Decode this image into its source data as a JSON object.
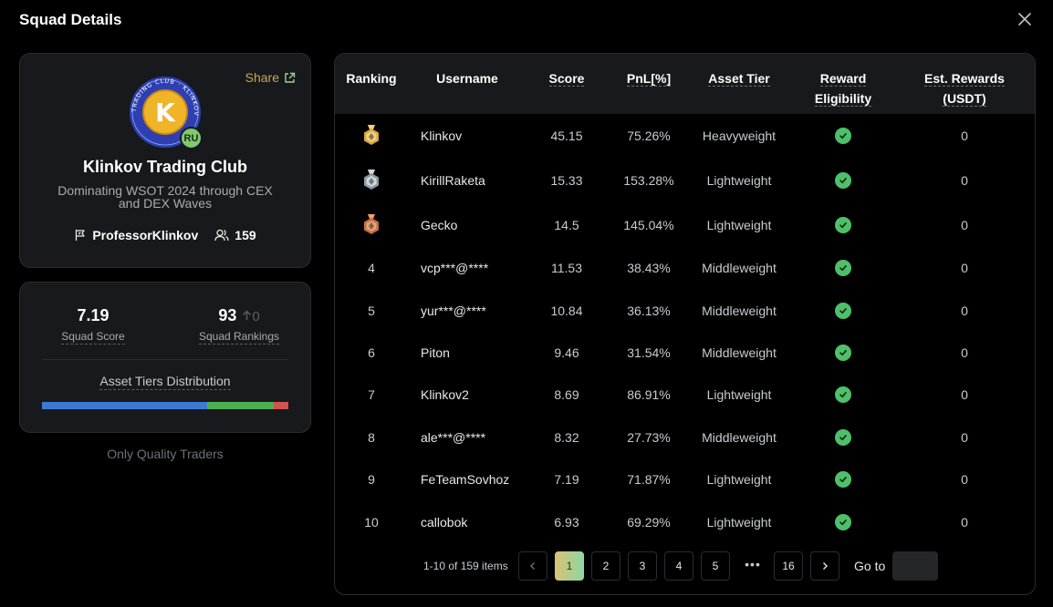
{
  "modal": {
    "title": "Squad Details"
  },
  "squad": {
    "share_label": "Share",
    "logo_text": "TRADING CLUB · KLINKOV",
    "logo_letter": "K",
    "region_badge": "RU",
    "name": "Klinkov Trading Club",
    "description": "Dominating WSOT 2024 through CEX and DEX Waves",
    "owner": "ProfessorKlinkov",
    "members": "159"
  },
  "stats": {
    "score_value": "7.19",
    "score_label": "Squad Score",
    "ranking_value": "93",
    "ranking_delta": "0",
    "ranking_label": "Squad Rankings",
    "distribution_label": "Asset Tiers Distribution",
    "distribution": [
      {
        "tier": "Lightweight",
        "share": 0.67,
        "color": "#3b7bd4"
      },
      {
        "tier": "Middleweight",
        "share": 0.27,
        "color": "#4caf50"
      },
      {
        "tier": "Heavyweight",
        "share": 0.06,
        "color": "#d25252"
      }
    ],
    "quality_note": "Only Quality Traders"
  },
  "table": {
    "headers": {
      "ranking": "Ranking",
      "username": "Username",
      "score": "Score",
      "pnl": "PnL[%]",
      "tier": "Asset Tier",
      "reward_line1": "Reward",
      "reward_line2": "Eligibility",
      "rewards_line1": "Est. Rewards",
      "rewards_line2": "(USDT)"
    },
    "rows": [
      {
        "rank": "",
        "medal": "gold",
        "username": "Klinkov",
        "score": "45.15",
        "pnl": "75.26%",
        "tier": "Heavyweight",
        "eligible": true,
        "rewards": "0"
      },
      {
        "rank": "",
        "medal": "silver",
        "username": "KirillRaketa",
        "score": "15.33",
        "pnl": "153.28%",
        "tier": "Lightweight",
        "eligible": true,
        "rewards": "0"
      },
      {
        "rank": "",
        "medal": "bronze",
        "username": "Gecko",
        "score": "14.5",
        "pnl": "145.04%",
        "tier": "Lightweight",
        "eligible": true,
        "rewards": "0"
      },
      {
        "rank": "4",
        "medal": "",
        "username": "vcp***@****",
        "score": "11.53",
        "pnl": "38.43%",
        "tier": "Middleweight",
        "eligible": true,
        "rewards": "0"
      },
      {
        "rank": "5",
        "medal": "",
        "username": "yur***@****",
        "score": "10.84",
        "pnl": "36.13%",
        "tier": "Middleweight",
        "eligible": true,
        "rewards": "0"
      },
      {
        "rank": "6",
        "medal": "",
        "username": "Piton",
        "score": "9.46",
        "pnl": "31.54%",
        "tier": "Middleweight",
        "eligible": true,
        "rewards": "0"
      },
      {
        "rank": "7",
        "medal": "",
        "username": "Klinkov2",
        "score": "8.69",
        "pnl": "86.91%",
        "tier": "Lightweight",
        "eligible": true,
        "rewards": "0"
      },
      {
        "rank": "8",
        "medal": "",
        "username": "ale***@****",
        "score": "8.32",
        "pnl": "27.73%",
        "tier": "Middleweight",
        "eligible": true,
        "rewards": "0"
      },
      {
        "rank": "9",
        "medal": "",
        "username": "FeTeamSovhoz",
        "score": "7.19",
        "pnl": "71.87%",
        "tier": "Lightweight",
        "eligible": true,
        "rewards": "0"
      },
      {
        "rank": "10",
        "medal": "",
        "username": "callobok",
        "score": "6.93",
        "pnl": "69.29%",
        "tier": "Lightweight",
        "eligible": true,
        "rewards": "0"
      }
    ]
  },
  "pagination": {
    "total_text": "1-10 of 159 items",
    "pages": [
      "1",
      "2",
      "3",
      "4",
      "5"
    ],
    "active_page": "1",
    "ellipsis": "•••",
    "last_page": "16",
    "goto_label": "Go to",
    "goto_value": ""
  },
  "colors": {
    "accent_gold": "#c7a85a",
    "eligible_green": "#4fbf6a",
    "card_bg": "#18191c"
  }
}
